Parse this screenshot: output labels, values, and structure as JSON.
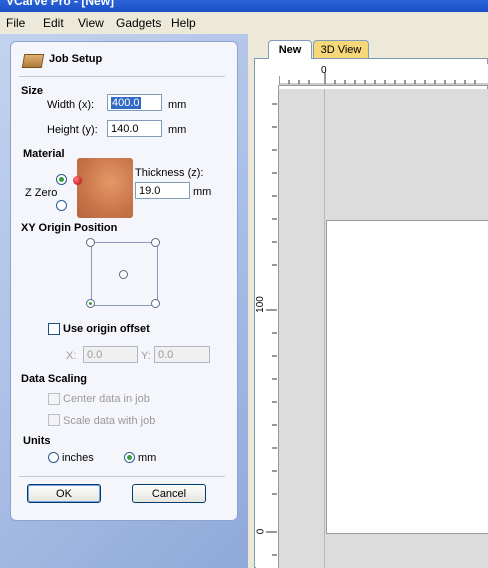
{
  "app": {
    "title": "VCarve Pro - [New]"
  },
  "menu": [
    "File",
    "Edit",
    "View",
    "Gadgets",
    "Help"
  ],
  "panel": {
    "title": "Job Setup",
    "size": {
      "heading": "Size",
      "width_label": "Width (x):",
      "width_value": "400.0",
      "height_label": "Height (y):",
      "height_value": "140.0",
      "unit": "mm"
    },
    "material": {
      "heading": "Material",
      "z_zero_label": "Z Zero",
      "thickness_label": "Thickness (z):",
      "thickness_value": "19.0",
      "unit": "mm"
    },
    "xy_origin": {
      "heading": "XY Origin Position",
      "use_offset_label": "Use origin offset",
      "x_label": "X:",
      "x_value": "0.0",
      "y_label": "Y:",
      "y_value": "0.0"
    },
    "data_scaling": {
      "heading": "Data Scaling",
      "center_label": "Center data in job",
      "scale_label": "Scale data with job"
    },
    "units": {
      "heading": "Units",
      "inches_label": "inches",
      "mm_label": "mm",
      "selected": "mm"
    },
    "buttons": {
      "ok": "OK",
      "cancel": "Cancel"
    }
  },
  "view": {
    "tabs": [
      "New",
      "3D View"
    ],
    "active_tab": "New",
    "ruler_top_zero": "0",
    "ruler_left_labels": [
      "100",
      "0"
    ]
  },
  "colors": {
    "tab_3d": "#f7d878",
    "titlebar": "#2a63d8",
    "panel_bg": "#f4f6fb"
  }
}
